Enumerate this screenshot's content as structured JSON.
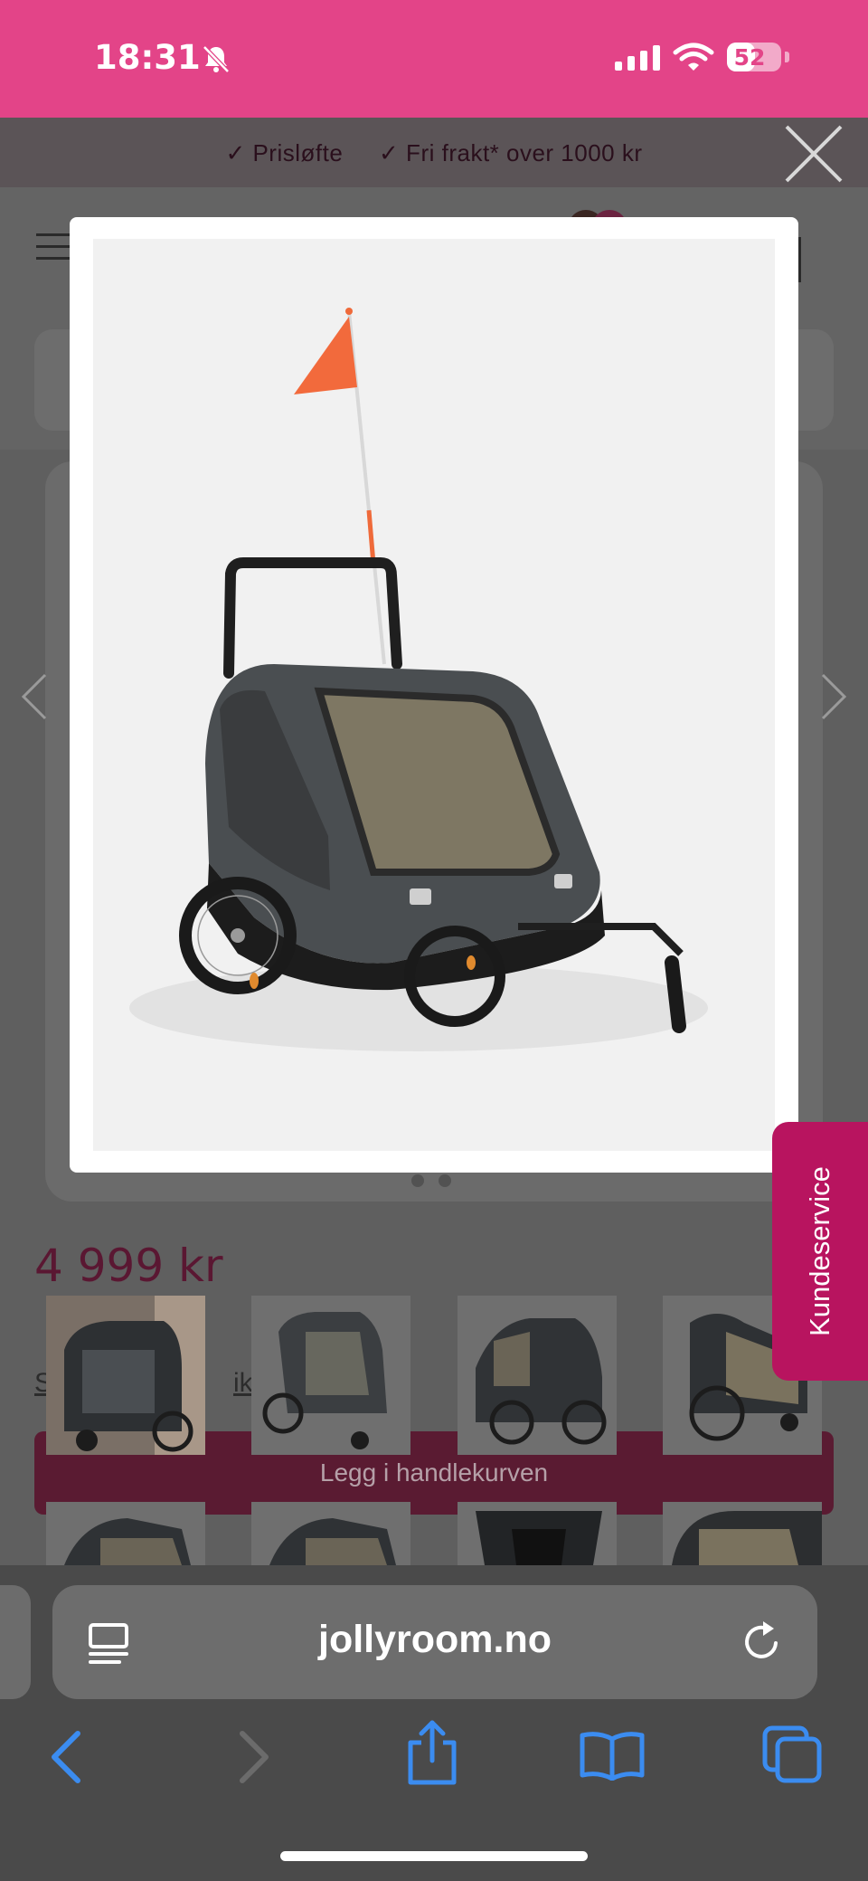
{
  "status_bar": {
    "time": "18:31",
    "battery": "52",
    "battery_level": 0.52
  },
  "promo": {
    "item1": "✓ Prisløfte",
    "item2": "✓ Fri frakt* over 1000 kr"
  },
  "product": {
    "price": "4 999 kr",
    "info_link": "S",
    "info_link_tail": "ikk",
    "add_to_cart": "Legg i handlekurven"
  },
  "side_tab": {
    "label": "Kundeservice"
  },
  "browser": {
    "url": "jollyroom.no"
  },
  "icons": {
    "close": "close-icon",
    "prev": "chevron-left-icon",
    "next": "chevron-right-icon",
    "reader": "reader-mode-icon",
    "reload": "reload-icon",
    "back": "back-arrow-icon",
    "forward": "forward-arrow-icon",
    "share": "share-icon",
    "bookmarks": "bookmarks-icon",
    "tabs": "tabs-icon"
  },
  "colors": {
    "status_bar": "#e34488",
    "side_tab": "#b8145f",
    "safari_blue": "#3b8cf0"
  }
}
